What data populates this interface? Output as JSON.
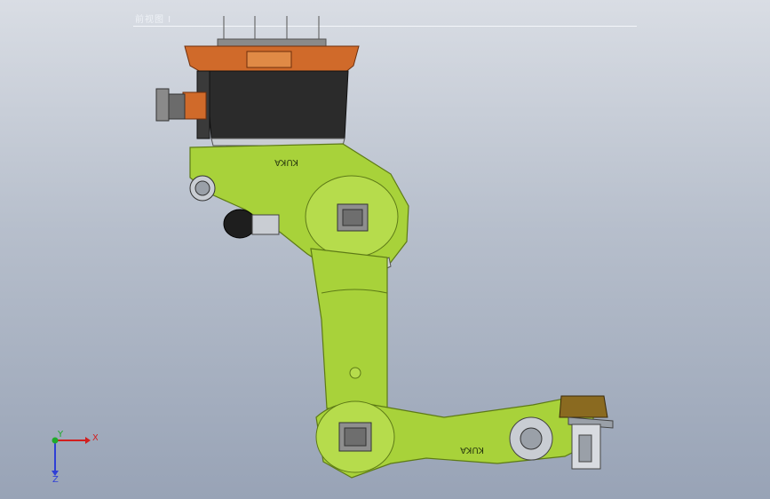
{
  "viewport": {
    "view_label": "前视图 I",
    "brand_text_upper": "KUKA",
    "brand_text_lower": "KUKA"
  },
  "triad": {
    "x_label": "X",
    "y_label": "Y",
    "z_label": "Z",
    "x_color": "#d21f1f",
    "y_color": "#1faa2a",
    "z_color": "#2f3fd6"
  },
  "colors": {
    "arm_green": "#a8d23a",
    "arm_green_dark": "#7ea226",
    "base_orange": "#d06a2a",
    "base_black": "#2a2a2a",
    "gray": "#9aa0a8"
  }
}
